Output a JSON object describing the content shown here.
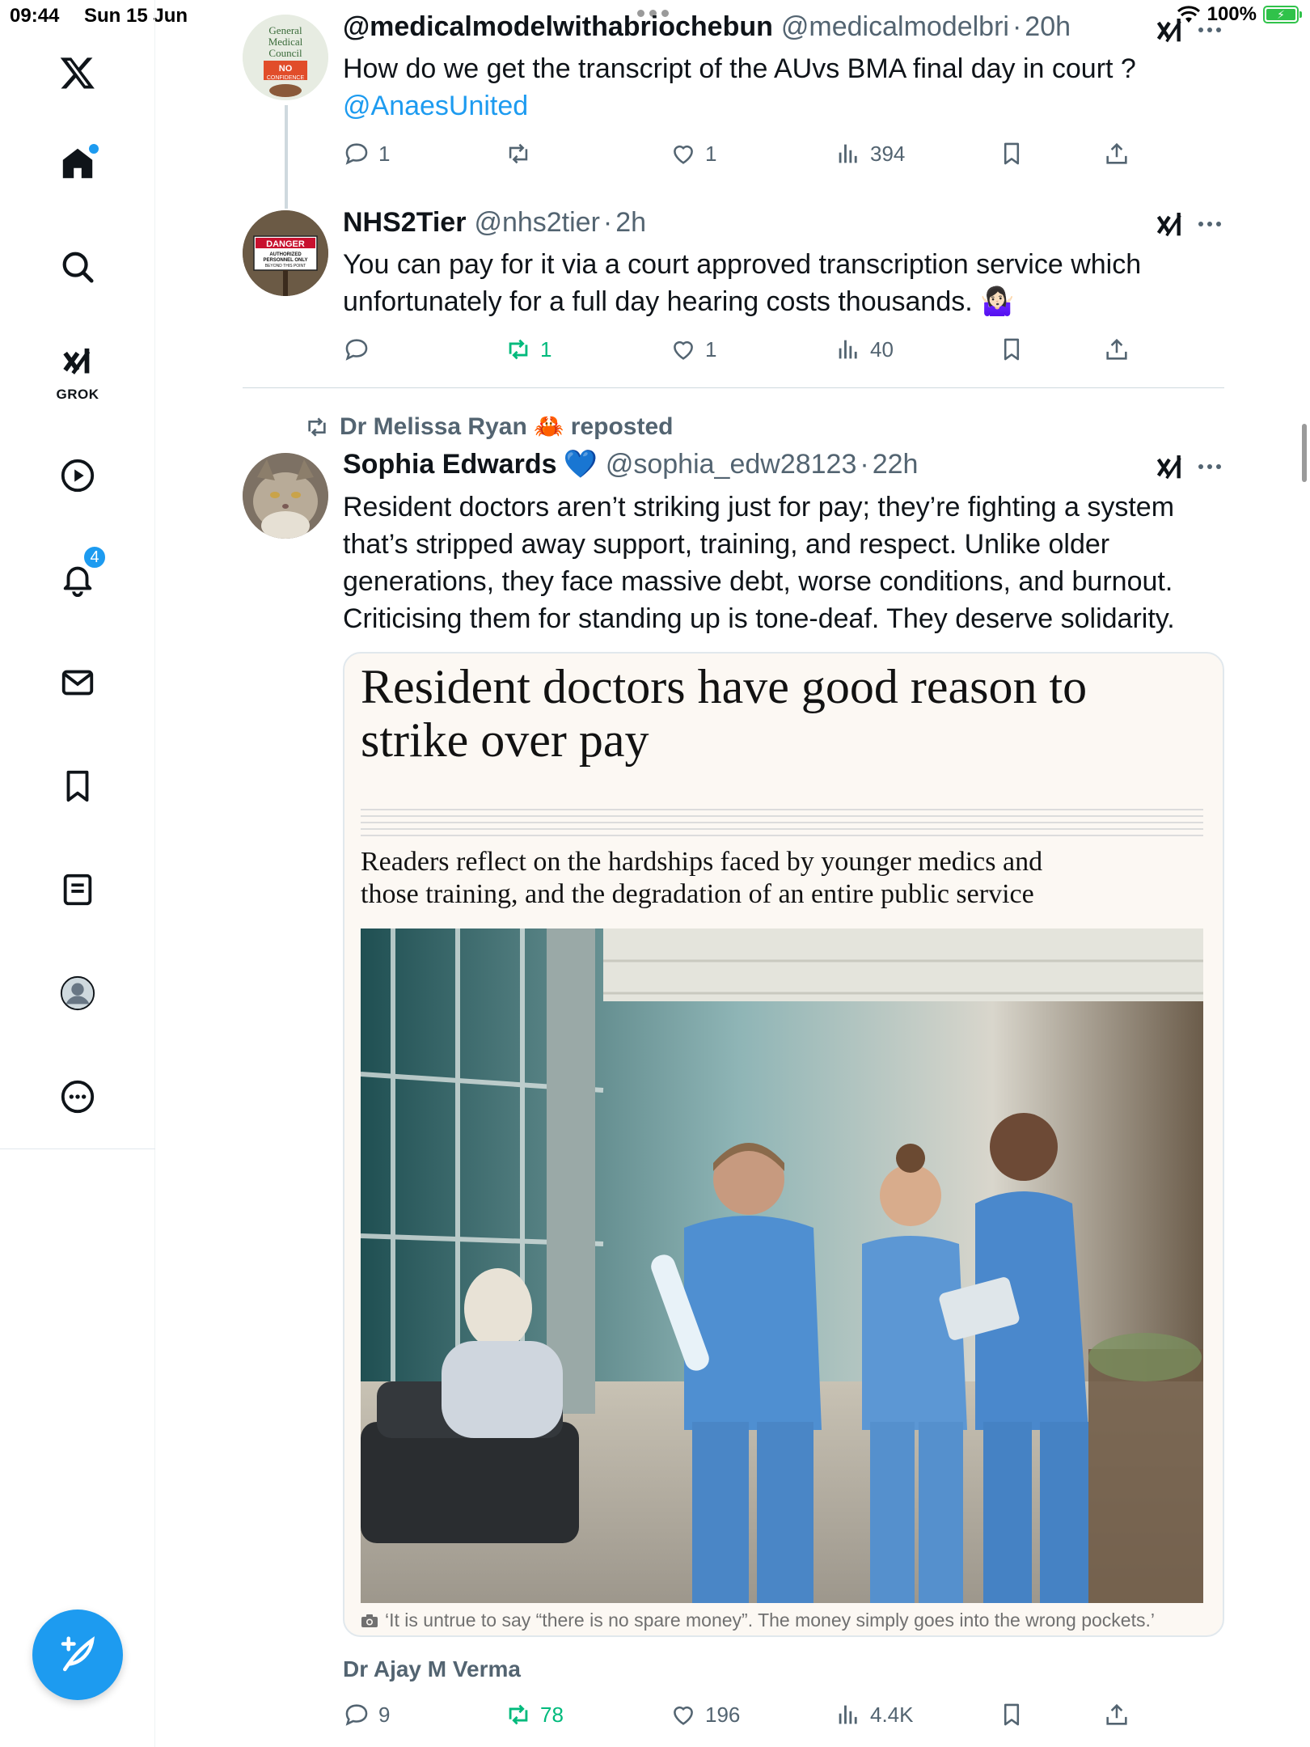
{
  "status_bar": {
    "time": "09:44",
    "date": "Sun 15 Jun",
    "battery": "100%"
  },
  "sidebar": {
    "grok_label": "GROK",
    "notifications_badge": "4",
    "items": [
      "X",
      "Home",
      "Explore",
      "Grok",
      "Video",
      "Notifications",
      "Messages",
      "Bookmarks",
      "Lists",
      "Profile",
      "More"
    ]
  },
  "tweets": [
    {
      "name": "@medicalmodelwithabriochebun",
      "handle": "@medicalmodelbri",
      "sep": "·",
      "time": "20h",
      "text": "How do we get the transcript of the AUvs BMA final day in court ?",
      "mention": "@AnaesUnited",
      "avatar_lines": [
        "General",
        "Medical",
        "Council",
        "NO",
        "CONFIDENCE"
      ],
      "stats": {
        "replies": "1",
        "reposts": "",
        "likes": "1",
        "views": "394"
      }
    },
    {
      "name": "NHS2Tier",
      "handle": "@nhs2tier",
      "sep": "·",
      "time": "2h",
      "text_line1": "You can pay for it via a court approved transcription service which",
      "text_line2": "unfortunately for a full day hearing costs thousands. 🤷🏻‍♀️",
      "avatar_lines": [
        "DANGER",
        "AUTHORIZED",
        "PERSONNEL ONLY",
        "BEYOND THIS POINT"
      ],
      "stats": {
        "replies": "",
        "reposts": "1",
        "likes": "1",
        "views": "40"
      }
    },
    {
      "reposted_by": "Dr Melissa Ryan 🦀 reposted",
      "name": "Sophia Edwards",
      "verified_emoji": "💙",
      "handle": "@sophia_edw28123",
      "sep": "·",
      "time": "22h",
      "text_lines": [
        "Resident doctors aren’t striking just for pay; they’re fighting a system",
        "that’s stripped away support, training, and respect. Unlike older",
        "generations, they face massive debt, worse conditions, and burnout.",
        "Criticising them for standing up is tone-deaf. They deserve solidarity."
      ],
      "card": {
        "headline_line1": "Resident doctors have good reason to",
        "headline_line2": "strike over pay",
        "standfirst_line1": "Readers reflect on the hardships faced by younger medics and",
        "standfirst_line2": "those training, and the degradation of an entire public service",
        "caption": "‘It is untrue to say “there is no spare money”. The money simply goes into the wrong pockets.’"
      },
      "byline": "Dr Ajay M Verma",
      "stats": {
        "replies": "9",
        "reposts": "78",
        "likes": "196",
        "views": "4.4K"
      }
    }
  ],
  "colors": {
    "accent": "#1d9bf0",
    "repost_green": "#00ba7c",
    "muted": "#536471"
  }
}
